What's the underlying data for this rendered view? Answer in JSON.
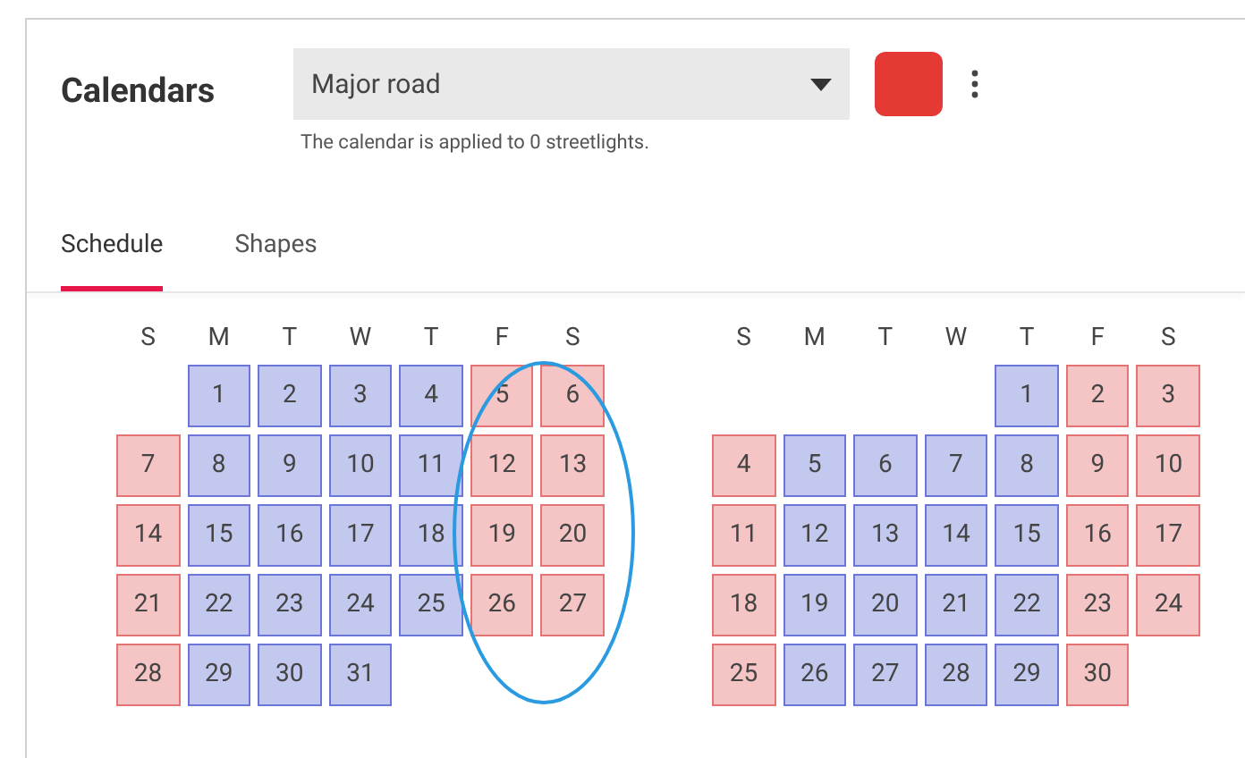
{
  "header": {
    "title": "Calendars",
    "dropdown": {
      "value": "Major road"
    },
    "color": "#e53935",
    "helper": "The calendar is applied to 0 streetlights."
  },
  "tabs": [
    {
      "label": "Schedule",
      "selected": true
    },
    {
      "label": "Shapes",
      "selected": false
    }
  ],
  "months": [
    {
      "weekdays": [
        "S",
        "M",
        "T",
        "W",
        "T",
        "F",
        "S"
      ],
      "weeks": [
        [
          {
            "kind": "blank"
          },
          {
            "day": "1",
            "kind": "weekday"
          },
          {
            "day": "2",
            "kind": "weekday"
          },
          {
            "day": "3",
            "kind": "weekday"
          },
          {
            "day": "4",
            "kind": "weekday"
          },
          {
            "day": "5",
            "kind": "weekend"
          },
          {
            "day": "6",
            "kind": "weekend"
          }
        ],
        [
          {
            "day": "7",
            "kind": "weekend"
          },
          {
            "day": "8",
            "kind": "weekday"
          },
          {
            "day": "9",
            "kind": "weekday"
          },
          {
            "day": "10",
            "kind": "weekday"
          },
          {
            "day": "11",
            "kind": "weekday"
          },
          {
            "day": "12",
            "kind": "weekend"
          },
          {
            "day": "13",
            "kind": "weekend"
          }
        ],
        [
          {
            "day": "14",
            "kind": "weekend"
          },
          {
            "day": "15",
            "kind": "weekday"
          },
          {
            "day": "16",
            "kind": "weekday"
          },
          {
            "day": "17",
            "kind": "weekday"
          },
          {
            "day": "18",
            "kind": "weekday"
          },
          {
            "day": "19",
            "kind": "weekend"
          },
          {
            "day": "20",
            "kind": "weekend"
          }
        ],
        [
          {
            "day": "21",
            "kind": "weekend"
          },
          {
            "day": "22",
            "kind": "weekday"
          },
          {
            "day": "23",
            "kind": "weekday"
          },
          {
            "day": "24",
            "kind": "weekday"
          },
          {
            "day": "25",
            "kind": "weekday"
          },
          {
            "day": "26",
            "kind": "weekend"
          },
          {
            "day": "27",
            "kind": "weekend"
          }
        ],
        [
          {
            "day": "28",
            "kind": "weekend"
          },
          {
            "day": "29",
            "kind": "weekday"
          },
          {
            "day": "30",
            "kind": "weekday"
          },
          {
            "day": "31",
            "kind": "weekday"
          },
          {
            "kind": "blank"
          },
          {
            "kind": "blank"
          },
          {
            "kind": "blank"
          }
        ]
      ]
    },
    {
      "weekdays": [
        "S",
        "M",
        "T",
        "W",
        "T",
        "F",
        "S"
      ],
      "weeks": [
        [
          {
            "kind": "blank"
          },
          {
            "kind": "blank"
          },
          {
            "kind": "blank"
          },
          {
            "kind": "blank"
          },
          {
            "day": "1",
            "kind": "weekday"
          },
          {
            "day": "2",
            "kind": "weekend"
          },
          {
            "day": "3",
            "kind": "weekend"
          }
        ],
        [
          {
            "day": "4",
            "kind": "weekend"
          },
          {
            "day": "5",
            "kind": "weekday"
          },
          {
            "day": "6",
            "kind": "weekday"
          },
          {
            "day": "7",
            "kind": "weekday"
          },
          {
            "day": "8",
            "kind": "weekday"
          },
          {
            "day": "9",
            "kind": "weekend"
          },
          {
            "day": "10",
            "kind": "weekend"
          }
        ],
        [
          {
            "day": "11",
            "kind": "weekend"
          },
          {
            "day": "12",
            "kind": "weekday"
          },
          {
            "day": "13",
            "kind": "weekday"
          },
          {
            "day": "14",
            "kind": "weekday"
          },
          {
            "day": "15",
            "kind": "weekday"
          },
          {
            "day": "16",
            "kind": "weekend"
          },
          {
            "day": "17",
            "kind": "weekend"
          }
        ],
        [
          {
            "day": "18",
            "kind": "weekend"
          },
          {
            "day": "19",
            "kind": "weekday"
          },
          {
            "day": "20",
            "kind": "weekday"
          },
          {
            "day": "21",
            "kind": "weekday"
          },
          {
            "day": "22",
            "kind": "weekday"
          },
          {
            "day": "23",
            "kind": "weekend"
          },
          {
            "day": "24",
            "kind": "weekend"
          }
        ],
        [
          {
            "day": "25",
            "kind": "weekend"
          },
          {
            "day": "26",
            "kind": "weekday"
          },
          {
            "day": "27",
            "kind": "weekday"
          },
          {
            "day": "28",
            "kind": "weekday"
          },
          {
            "day": "29",
            "kind": "weekday"
          },
          {
            "day": "30",
            "kind": "weekend"
          },
          {
            "kind": "blank"
          }
        ]
      ]
    }
  ]
}
